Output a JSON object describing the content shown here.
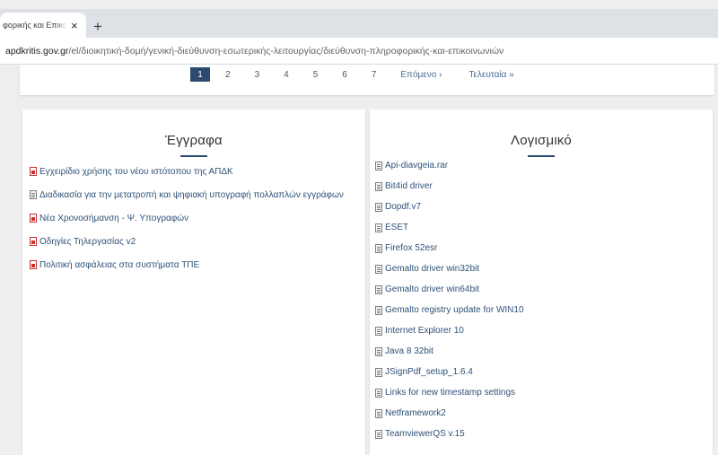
{
  "browser": {
    "tab_title": "φορικής και Επικοινωνιών",
    "tab_close": "×",
    "new_tab": "+",
    "url_host": "apdkritis.gov.gr",
    "url_path": "/el/διοικητική-δομή/γενική-διεύθυνση-εσωτερικής-λειτουργίας/διεύθυνση-πληροφορικής-και-επικοινωνιών"
  },
  "pager": {
    "pages": [
      "1",
      "2",
      "3",
      "4",
      "5",
      "6",
      "7"
    ],
    "current": "1",
    "next": "Επόμενο ›",
    "last": "Τελευταία »"
  },
  "documents": {
    "title": "Έγγραφα",
    "items": [
      {
        "label": "Εγχειρίδιο χρήσης του νέου ιστότοπου της ΑΠΔΚ",
        "icon": "pdf-icon"
      },
      {
        "label": "Διαδικασία για την μετατροπή και ψηφιακή υπογραφή πολλαπλών εγγράφων",
        "icon": "file-icon"
      },
      {
        "label": "Νέα Χρονοσήμανση - Ψ. Υπογραφών",
        "icon": "pdf-icon"
      },
      {
        "label": "Οδηγίες Τηλεργασίας v2",
        "icon": "pdf-icon"
      },
      {
        "label": "Πολιτική ασφάλειας στα συστήματα ΤΠΕ",
        "icon": "pdf-icon"
      }
    ]
  },
  "software": {
    "title": "Λογισμικό",
    "items": [
      {
        "label": "Api-diavgeia.rar",
        "icon": "file-icon"
      },
      {
        "label": "Bit4id driver",
        "icon": "file-icon"
      },
      {
        "label": "Dopdf.v7",
        "icon": "file-icon"
      },
      {
        "label": "ESET",
        "icon": "file-icon"
      },
      {
        "label": "Firefox 52esr",
        "icon": "file-icon"
      },
      {
        "label": "Gemalto driver win32bit",
        "icon": "file-icon"
      },
      {
        "label": "Gemalto driver win64bit",
        "icon": "file-icon"
      },
      {
        "label": "Gemalto registry update for WIN10",
        "icon": "file-icon"
      },
      {
        "label": "Internet Explorer 10",
        "icon": "file-icon"
      },
      {
        "label": "Java 8 32bit",
        "icon": "file-icon"
      },
      {
        "label": "JSignPdf_setup_1.6.4",
        "icon": "file-icon"
      },
      {
        "label": "Links for new timestamp settings",
        "icon": "file-icon"
      },
      {
        "label": "Netframework2",
        "icon": "file-icon"
      },
      {
        "label": "TeamviewerQS v.15",
        "icon": "file-icon"
      }
    ]
  },
  "colors": {
    "accent": "#2c4a70",
    "link": "#2e5178",
    "pdf_red": "#c9302c"
  }
}
